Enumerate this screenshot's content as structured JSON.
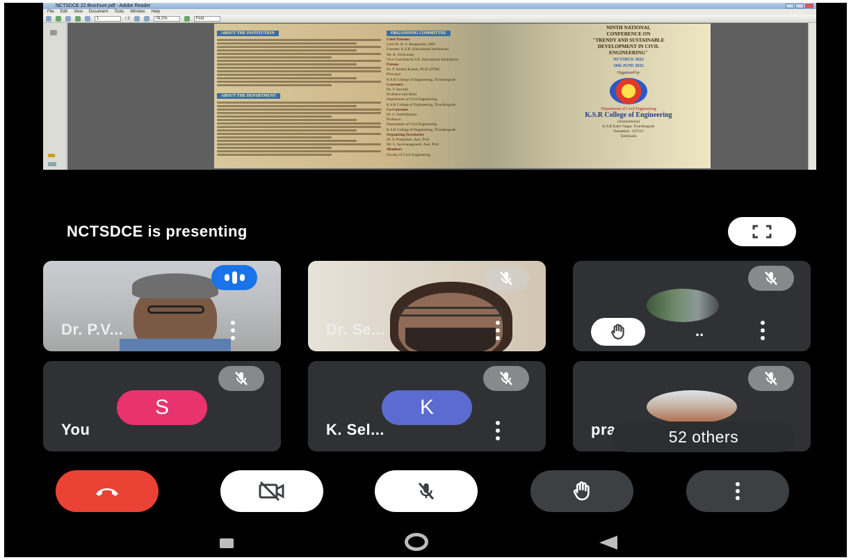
{
  "reader": {
    "window_title": "NCTSDCE 22 Brochure.pdf - Adobe Reader",
    "menu": [
      "File",
      "Edit",
      "View",
      "Document",
      "Tools",
      "Window",
      "Help"
    ],
    "zoom": "78.2%",
    "page_field": "1",
    "page_total": "/ 2",
    "find_field": "Find"
  },
  "brochure": {
    "about_institution": "ABOUT THE INSTITUTION",
    "about_department": "ABOUT THE DEPARTMENT",
    "organising_committee": "ORGANISING COMMITTEE",
    "committee": [
      {
        "text": "Chief Patrons:",
        "bold": true
      },
      {
        "text": "Lion Dr. R. S. Rangasamy, MJF",
        "bold": false
      },
      {
        "text": "Founder, K.S.R. Educational Institutions",
        "bold": false
      },
      {
        "text": "Mr. R. Srinivasan,",
        "bold": false
      },
      {
        "text": "Vice Chairman K.S.R. Educational Institutions",
        "bold": false
      },
      {
        "text": "Patron:",
        "bold": true
      },
      {
        "text": "Dr. P. Senthil Kumar, Ph.D (IITM)",
        "bold": false
      },
      {
        "text": "Principal",
        "bold": false
      },
      {
        "text": "K.S.R College of Engineering, Tiruchengode",
        "bold": false
      },
      {
        "text": "Convener:",
        "bold": true
      },
      {
        "text": "Dr. V. Revathi",
        "bold": false
      },
      {
        "text": "Professor and Head",
        "bold": false
      },
      {
        "text": "Department of Civil Engineering",
        "bold": false
      },
      {
        "text": "K.S.R College of Engineering, Tiruchengode",
        "bold": false
      },
      {
        "text": "Co-Convener",
        "bold": true
      },
      {
        "text": "Dr. S. Senthilkumar",
        "bold": false
      },
      {
        "text": "Professor",
        "bold": false
      },
      {
        "text": "Department of Civil Engineering",
        "bold": false
      },
      {
        "text": "K.S.R College of Engineering, Tiruchengode",
        "bold": false
      },
      {
        "text": "Organizing Secretaries",
        "bold": true
      },
      {
        "text": "Dr. P. Prasanthni, Asst. Prof",
        "bold": false
      },
      {
        "text": "Mr. S. Saravanaganesh, Asst. Prof",
        "bold": false
      },
      {
        "text": "Members",
        "bold": true
      },
      {
        "text": "Faculty of Civil Engineering",
        "bold": false
      }
    ],
    "conference_lines": [
      "NINTH NATIONAL",
      "CONFERENCE ON",
      "\"TRENDY AND SUSTAINABLE",
      "DEVELOPMENT IN CIVIL",
      "ENGINEERING\""
    ],
    "acronym": "NCTSDCE 2022",
    "date": "10th JUNE 2022",
    "organized_by": "Organized by",
    "dept": "Department of Civil Engineering",
    "college": "K.S.R College of Engineering",
    "address": [
      "(Autonomous)",
      "K.S.R Kalvi Nagar, Tiruchengode",
      "Namakkal - 637215",
      "Tamilnadu"
    ]
  },
  "presenting": {
    "label": "NCTSDCE is presenting"
  },
  "participants": [
    {
      "name": "Dr. P.V...",
      "state": "speaking"
    },
    {
      "name": "Dr. Se...",
      "state": "muted"
    },
    {
      "name": "..",
      "state": "muted",
      "hand_raised": true
    },
    {
      "name": "You",
      "state": "muted",
      "avatar_letter": "S",
      "avatar_color": "#e8336f"
    },
    {
      "name": "K. Sel...",
      "state": "muted",
      "avatar_letter": "K",
      "avatar_color": "#5b6bd0"
    },
    {
      "name": "pra",
      "state": "muted"
    }
  ],
  "others": {
    "label": "52 others"
  },
  "controls": {
    "end_call_icon": "phone-hangup-icon",
    "camera_icon": "video-off-icon",
    "mic_icon": "mic-off-icon",
    "hand_icon": "raise-hand-icon",
    "more_icon": "more-vert-icon"
  },
  "colors": {
    "end_call": "#ea4335",
    "speaking": "#1a73e8",
    "tile_bg": "#3c4043"
  }
}
